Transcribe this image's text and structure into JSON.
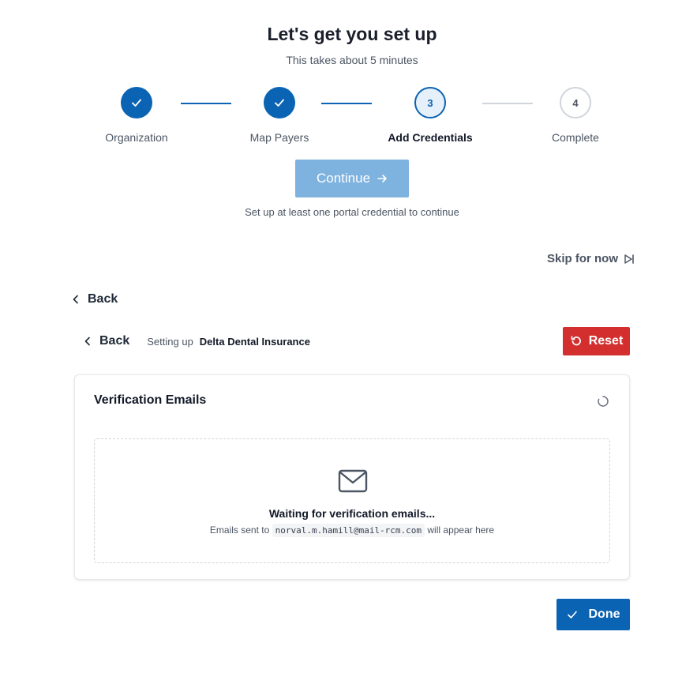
{
  "header": {
    "title": "Let's get you set up",
    "subtitle": "This takes about 5 minutes"
  },
  "stepper": {
    "steps": [
      {
        "label": "Organization",
        "status": "done",
        "number": "1"
      },
      {
        "label": "Map Payers",
        "status": "done",
        "number": "2"
      },
      {
        "label": "Add Credentials",
        "status": "current",
        "number": "3"
      },
      {
        "label": "Complete",
        "status": "todo",
        "number": "4"
      }
    ]
  },
  "actions": {
    "continue_label": "Continue",
    "continue_hint": "Set up at least one portal credential to continue",
    "skip_label": "Skip for now",
    "back_label": "Back"
  },
  "setup": {
    "back_label": "Back",
    "setting_up_label": "Setting up",
    "provider_name": "Delta Dental Insurance",
    "reset_label": "Reset"
  },
  "verification": {
    "title": "Verification Emails",
    "waiting_text": "Waiting for verification emails...",
    "emails_sent_prefix": "Emails sent to",
    "email_address": "norval.m.hamill@mail-rcm.com",
    "emails_sent_suffix": "will appear here"
  },
  "footer": {
    "done_label": "Done"
  },
  "colors": {
    "primary": "#0b63b3",
    "primary_disabled": "#7eb2df",
    "danger": "#d32f2f",
    "border": "#e5e7eb"
  },
  "icons": {
    "step_done": "check-icon",
    "continue": "arrow-right-icon",
    "skip": "skip-forward-icon",
    "back": "chevron-left-icon",
    "reset": "refresh-icon",
    "loading": "spinner-icon",
    "email": "mail-icon",
    "done": "check-icon"
  }
}
